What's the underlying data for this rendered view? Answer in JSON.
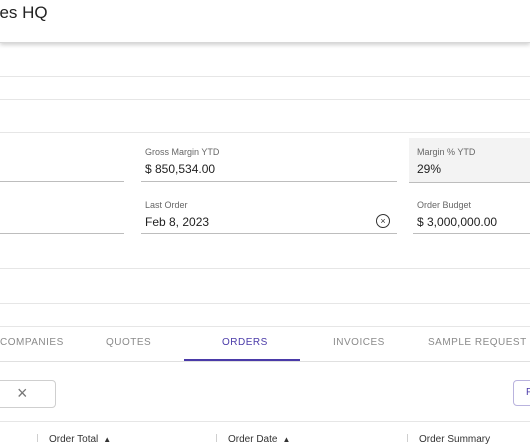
{
  "header": {
    "title": "ries HQ"
  },
  "fields": {
    "gross_margin_ytd": {
      "label": "Gross Margin YTD",
      "value": "$ 850,534.00"
    },
    "margin_pct_ytd": {
      "label": "Margin % YTD",
      "value": "29%"
    },
    "last_order": {
      "label": "Last Order",
      "value": "Feb 8, 2023"
    },
    "order_budget": {
      "label": "Order Budget",
      "value": "$ 3,000,000.00"
    }
  },
  "tabs": [
    {
      "label": "COMPANIES"
    },
    {
      "label": "QUOTES"
    },
    {
      "label": "ORDERS"
    },
    {
      "label": "INVOICES"
    },
    {
      "label": "SAMPLE REQUEST"
    }
  ],
  "toolbar": {
    "search_clear": "×",
    "right_button_label": "F"
  },
  "table": {
    "columns": [
      {
        "label": "Order Total",
        "sort": "▲"
      },
      {
        "label": "Order Date",
        "sort": "▲"
      },
      {
        "label": "Order Summary"
      }
    ]
  },
  "colors": {
    "accent": "#4a3aa8",
    "muted_text": "#8a8a8a"
  }
}
